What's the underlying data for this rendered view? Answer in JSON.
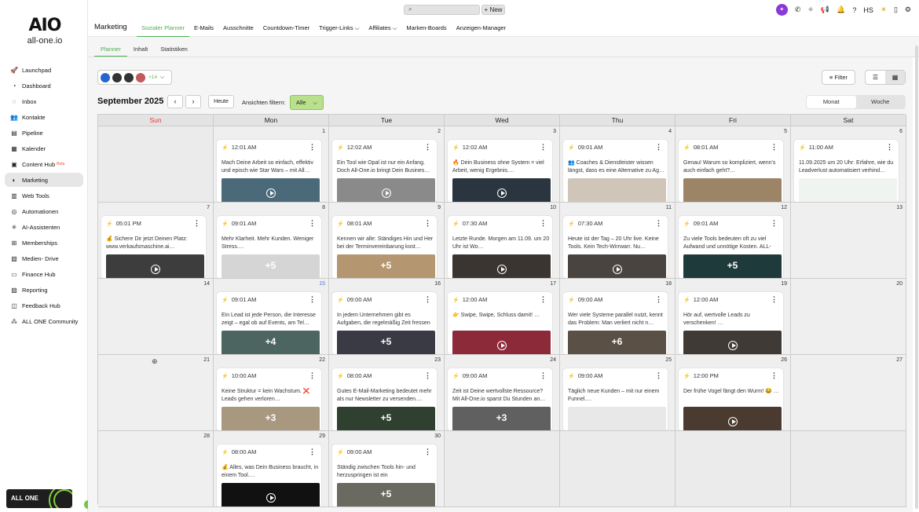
{
  "brand": {
    "logo_mark": "AIO",
    "logo_text": "all-one.io",
    "footer_label": "ALL ONE"
  },
  "sidebar": {
    "items": [
      {
        "label": "Launchpad",
        "icon": "rocket-icon",
        "glyph": "🚀"
      },
      {
        "label": "Dashboard",
        "icon": "gauge-icon",
        "glyph": "◔"
      },
      {
        "label": "Inbox",
        "icon": "chat-icon",
        "glyph": "◌"
      },
      {
        "label": "Kontakte",
        "icon": "users-icon",
        "glyph": "👥"
      },
      {
        "label": "Pipeline",
        "icon": "funnel-icon",
        "glyph": "▤"
      },
      {
        "label": "Kalender",
        "icon": "calendar-icon",
        "glyph": "▦"
      },
      {
        "label": "Content Hub",
        "icon": "content-icon",
        "glyph": "▣",
        "badge": "Beta"
      },
      {
        "label": "Marketing",
        "icon": "megaphone-icon",
        "glyph": "◐",
        "active": true
      },
      {
        "label": "Web Tools",
        "icon": "globe-icon",
        "glyph": "▥"
      },
      {
        "label": "Automationen",
        "icon": "automation-icon",
        "glyph": "◎"
      },
      {
        "label": "AI-Assistenten",
        "icon": "ai-icon",
        "glyph": "✳"
      },
      {
        "label": "Memberships",
        "icon": "membership-icon",
        "glyph": "⊞"
      },
      {
        "label": "Medien- Drive",
        "icon": "media-icon",
        "glyph": "▧"
      },
      {
        "label": "Finance Hub",
        "icon": "finance-icon",
        "glyph": "▭"
      },
      {
        "label": "Reporting",
        "icon": "reporting-icon",
        "glyph": "▨"
      },
      {
        "label": "Feedback Hub",
        "icon": "feedback-icon",
        "glyph": "◫"
      },
      {
        "label": "ALL ONE Community",
        "icon": "community-icon",
        "glyph": "⁂"
      }
    ]
  },
  "topbar": {
    "search_icon": "search-icon",
    "new_label": "+ New",
    "user_initials": "HS"
  },
  "header": {
    "section": "Marketing",
    "tabs": [
      {
        "label": "Sozialer Planner",
        "active": true
      },
      {
        "label": "E-Mails"
      },
      {
        "label": "Ausschnitte"
      },
      {
        "label": "Countdown-Timer"
      },
      {
        "label": "Trigger-Links ⌵"
      },
      {
        "label": "Affiliates ⌵"
      },
      {
        "label": "Marken-Boards"
      },
      {
        "label": "Anzeigen-Manager"
      }
    ],
    "subtabs": [
      {
        "label": "Planner",
        "active": true
      },
      {
        "label": "Inhalt"
      },
      {
        "label": "Statistiken"
      }
    ]
  },
  "toolbar": {
    "accounts_more": "+14",
    "filter_label": "Filter",
    "month_title": "September 2025",
    "prev": "‹",
    "next": "›",
    "today": "Heute",
    "view_filter_label": "Ansichten filtern:",
    "view_filter_value": "Alle",
    "month_label": "Monat",
    "week_label": "Woche"
  },
  "calendar": {
    "weekdays": [
      "Sun",
      "Mon",
      "Tue",
      "Wed",
      "Thu",
      "Fri",
      "Sat"
    ],
    "weeks": [
      [
        {
          "day": ""
        },
        {
          "day": "1",
          "time": "12:01 AM",
          "text": "Mach Deine Arbeit so einfach, effektiv und episch wie Star Wars – mit All…",
          "img": "#4a6a7a",
          "play": true
        },
        {
          "day": "2",
          "time": "12:02 AM",
          "text": "Ein Tool wie Opal ist nur ein Anfang. Doch All-One.io bringt Dein Busines…",
          "img": "#8a8a8a",
          "play": true
        },
        {
          "day": "3",
          "time": "12:02 AM",
          "text": "🔥 Dein Business ohne System = viel Arbeit, wenig Ergebnis.…",
          "img": "#2a3540",
          "play": true
        },
        {
          "day": "4",
          "time": "09:01 AM",
          "text": "👥 Coaches & Dienstleister wissen längst, dass es eine Alternative zu Ag…",
          "img": "#cfc5b8",
          "play": false
        },
        {
          "day": "5",
          "time": "08:01 AM",
          "text": "Genau! Warum so kompliziert, wenn's auch einfach geht?…",
          "img": "#9c8466",
          "play": false
        },
        {
          "day": "6",
          "time": "11:00 AM",
          "text": "11.09.2025 um 20 Uhr: Erfahre, wie du Leadverlust automatisiert verhind…",
          "img": "#f0f4f0",
          "play": false
        }
      ],
      [
        {
          "day": "7",
          "time": "05:01 PM",
          "text": "💰 Sichere Dir jetzt Deinen Platz: www.verkaufsmaschine.ai…",
          "img": "#3d3d3d",
          "play": true
        },
        {
          "day": "8",
          "time": "09:01 AM",
          "text": "Mehr Klarheit. Mehr Kunden. Weniger Stress.…",
          "img": "#d5d5d5",
          "more": "+5"
        },
        {
          "day": "9",
          "time": "08:01 AM",
          "text": "Kennen wir alle: Ständiges Hin und Her bei der Terminvereinbarung kost…",
          "img": "#b49670",
          "more": "+5"
        },
        {
          "day": "10",
          "time": "07:30 AM",
          "text": "Letzte Runde. Morgen am 11.09. um 20 Uhr ist Wo…",
          "img": "#3a3530",
          "play": true
        },
        {
          "day": "11",
          "time": "07:30 AM",
          "text": "Heute ist der Tag – 20 Uhr live. Keine Tools. Kein Tech-Wirrwarr. Nu…",
          "img": "#4a4440",
          "play": true
        },
        {
          "day": "12",
          "time": "09:01 AM",
          "text": "Zu viele Tools bedeuten oft zu viel Aufwand und unnötige Kosten. ALL-O…",
          "img": "#1f3a3a",
          "more": "+5"
        },
        {
          "day": "13"
        }
      ],
      [
        {
          "day": "14"
        },
        {
          "day": "15",
          "blue": true,
          "time": "09:01 AM",
          "text": "Ein Lead ist jede Person, die Interesse zeigt – egal ob auf Events, am Tel…",
          "img": "#4d6560",
          "more": "+4"
        },
        {
          "day": "16",
          "time": "09:00 AM",
          "text": "In jedem Unternehmen gibt es Aufgaben, die regelmäßig Zeit fressen un…",
          "img": "#3a3a44",
          "more": "+5"
        },
        {
          "day": "17",
          "time": "12:00 AM",
          "text": "👉 Swipe, Swipe, Schluss damit! …",
          "img": "#8c2a3a",
          "play": true
        },
        {
          "day": "18",
          "time": "09:00 AM",
          "text": "Wer viele Systeme parallel nutzt, kennt das Problem: Man verliert nicht n…",
          "img": "#5a5045",
          "more": "+6"
        },
        {
          "day": "19",
          "time": "12:00 AM",
          "text": "Hör auf, wertvolle Leads zu verschenken! …",
          "img": "#3f3a35",
          "play": true
        },
        {
          "day": "20"
        }
      ],
      [
        {
          "day": "21",
          "plus": true
        },
        {
          "day": "22",
          "time": "10:00 AM",
          "text": "Keine Struktur = kein Wachstum. ❌ Leads gehen verloren…",
          "img": "#a89880",
          "more": "+3"
        },
        {
          "day": "23",
          "time": "08:00 AM",
          "text": "Gutes E-Mail-Marketing bedeutet mehr als nur Newsletter zu versenden.…",
          "img": "#2f3f30",
          "more": "+5"
        },
        {
          "day": "24",
          "time": "09:00 AM",
          "text": "Zeit ist Deine wertvollste Ressource? Mit All-One.io sparst Du Stunden an…",
          "img": "#606060",
          "more": "+3"
        },
        {
          "day": "25",
          "time": "09:00 AM",
          "text": "Täglich neue Kunden – mit nur einem Funnel.…",
          "img": "#e8e8e8",
          "play": false
        },
        {
          "day": "26",
          "time": "12:00 PM",
          "text": "Der frühe Vogel fängt den Wurm! 😂 …",
          "img": "#4a3a30",
          "play": true
        },
        {
          "day": "27"
        }
      ],
      [
        {
          "day": "28"
        },
        {
          "day": "29",
          "time": "08:00 AM",
          "text": "💰 Alles, was Dein Business braucht, in einem Tool.…",
          "img": "#111111",
          "play": true
        },
        {
          "day": "30",
          "time": "09:00 AM",
          "text": "Ständig zwischen Tools hin- und herzuspringen ist ein Produktivitätskiller.…",
          "img": "#6a6a60",
          "more": "+5"
        },
        {
          "day": ""
        },
        {
          "day": ""
        },
        {
          "day": ""
        },
        {
          "day": ""
        }
      ]
    ]
  }
}
